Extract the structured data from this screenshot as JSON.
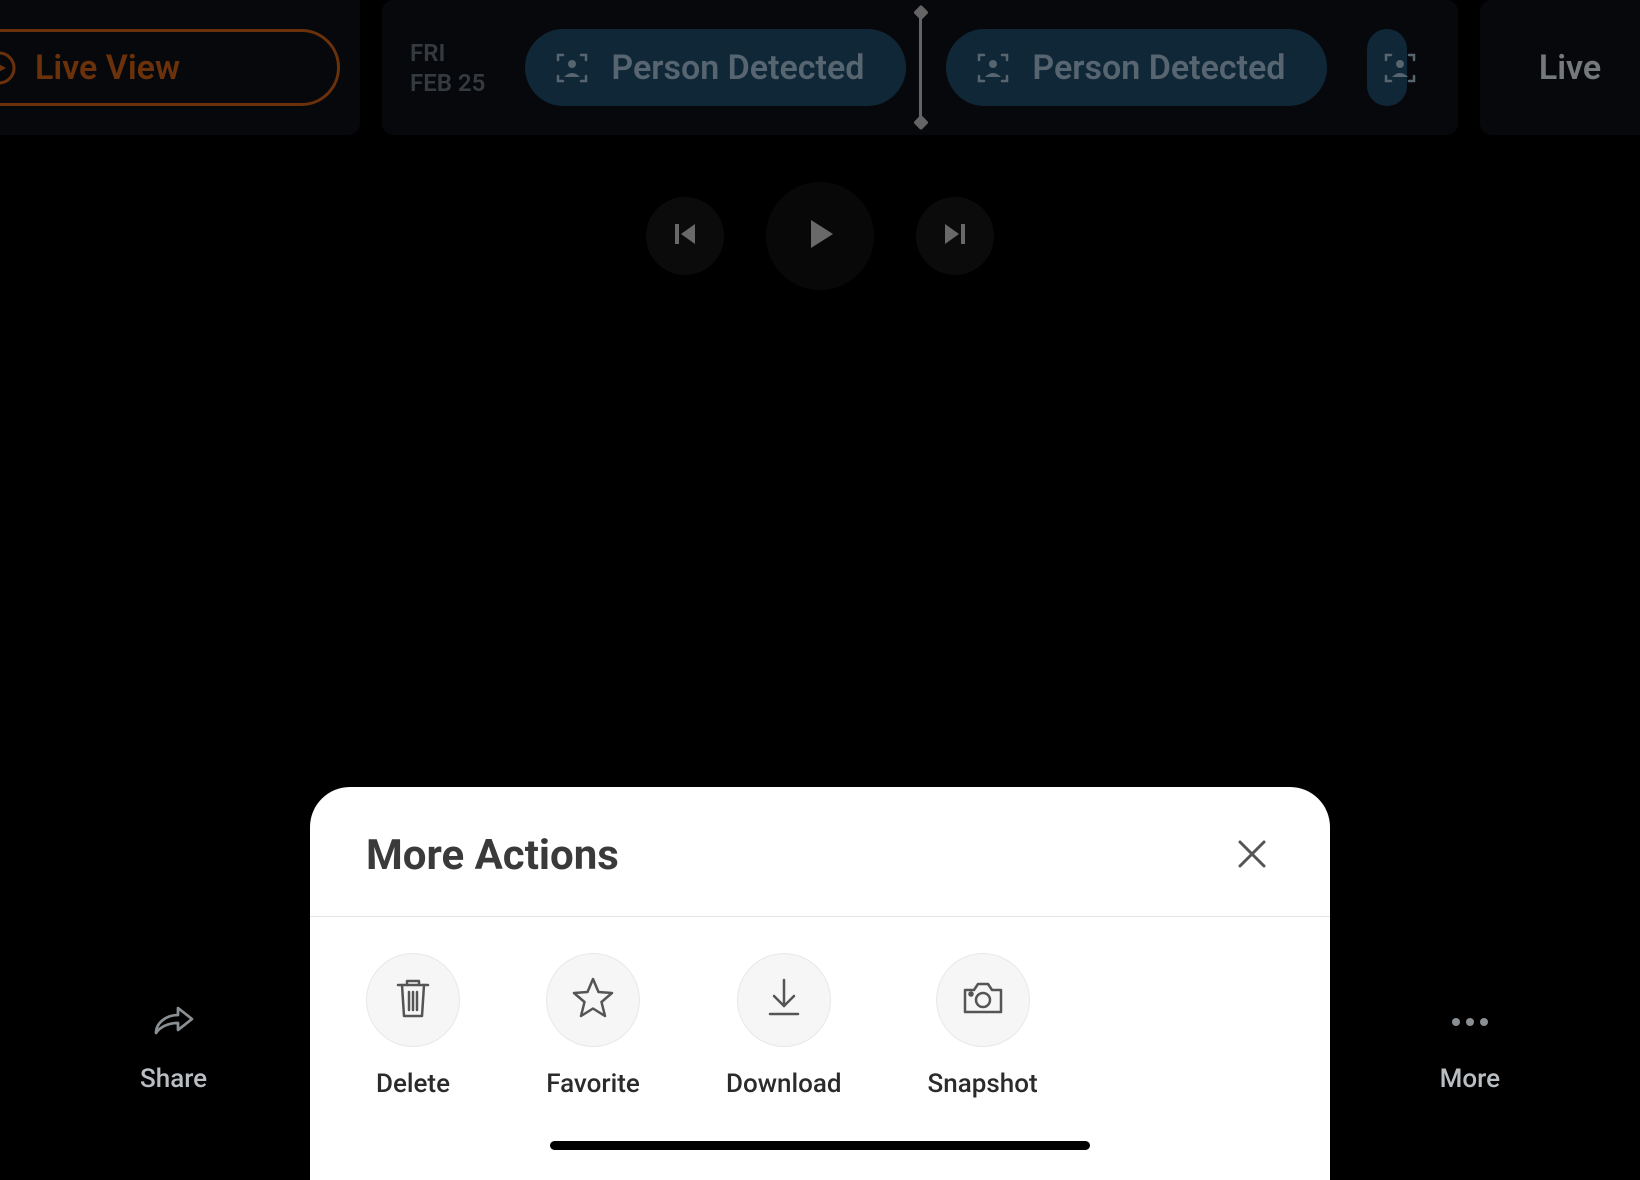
{
  "timeline": {
    "live_view_label": "Live View",
    "date_day": "FRI",
    "date_md": "FEB 25",
    "events": [
      {
        "label": "Person Detected"
      },
      {
        "label": "Person Detected"
      }
    ],
    "live_label": "Live"
  },
  "bottom": {
    "share_label": "Share",
    "more_label": "More"
  },
  "sheet": {
    "title": "More Actions",
    "actions": {
      "delete": "Delete",
      "favorite": "Favorite",
      "download": "Download",
      "snapshot": "Snapshot"
    }
  }
}
